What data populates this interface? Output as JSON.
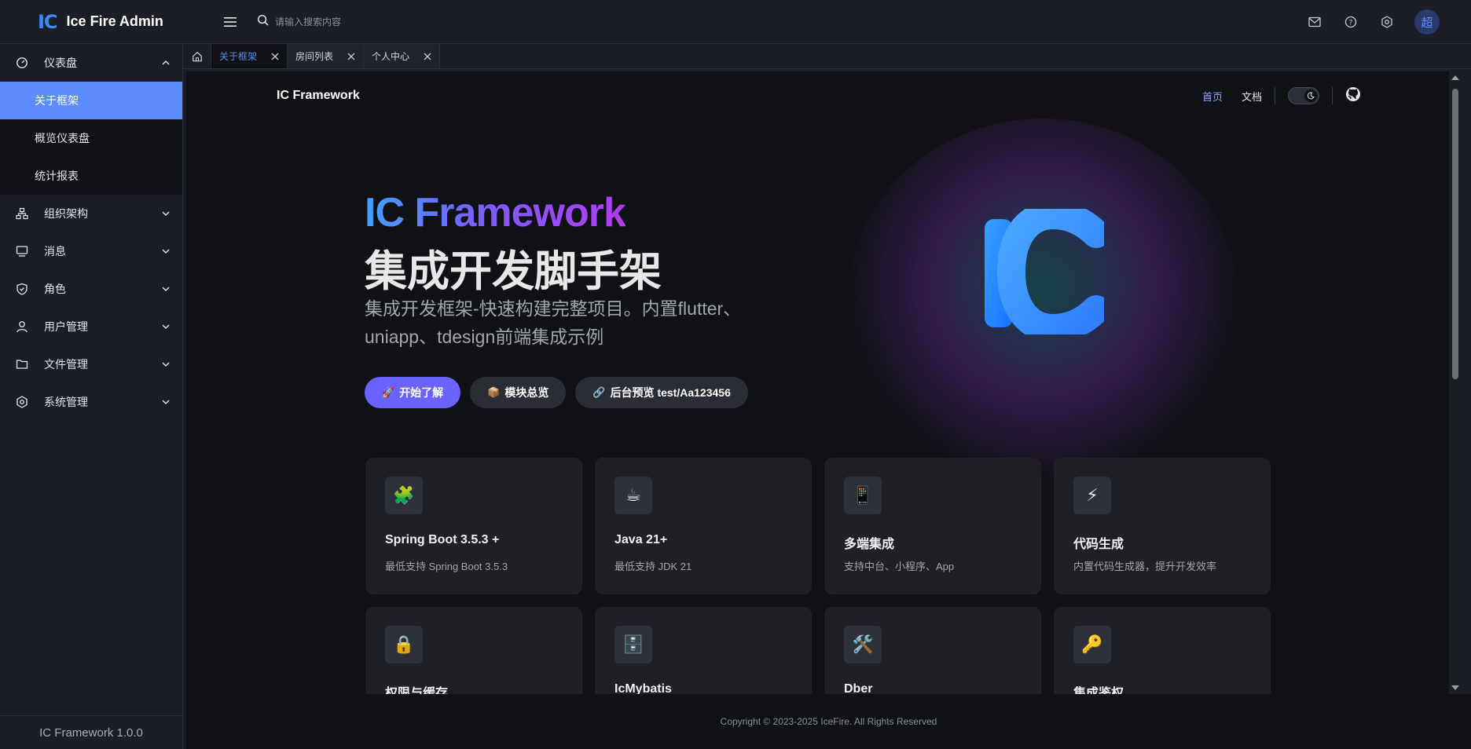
{
  "app": {
    "logo_mark": "IC",
    "title": "Ice Fire Admin",
    "avatar_text": "超"
  },
  "search": {
    "placeholder": "请输入搜索内容"
  },
  "sidebar": {
    "groups": [
      {
        "label": "仪表盘",
        "icon": "dashboard-icon",
        "expanded": true,
        "items": [
          {
            "label": "关于框架",
            "active": true
          },
          {
            "label": "概览仪表盘"
          },
          {
            "label": "统计报表"
          }
        ]
      },
      {
        "label": "组织架构",
        "icon": "org-chart-icon"
      },
      {
        "label": "消息",
        "icon": "message-icon"
      },
      {
        "label": "角色",
        "icon": "shield-icon"
      },
      {
        "label": "用户管理",
        "icon": "user-icon"
      },
      {
        "label": "文件管理",
        "icon": "folder-icon"
      },
      {
        "label": "系统管理",
        "icon": "gear-icon"
      }
    ],
    "footer": "IC Framework 1.0.0"
  },
  "tabs": [
    {
      "label": "关于框架",
      "active": true
    },
    {
      "label": "房间列表"
    },
    {
      "label": "个人中心"
    }
  ],
  "page": {
    "brand": "IC Framework",
    "nav": {
      "home": "首页",
      "docs": "文档"
    },
    "hero": {
      "title1": "IC Framework",
      "title2": "集成开发脚手架",
      "subtitle": "集成开发框架-快速构建完整项目。内置flutter、uniapp、tdesign前端集成示例"
    },
    "buttons": [
      {
        "emoji": "🚀",
        "label": "开始了解"
      },
      {
        "emoji": "📦",
        "label": "模块总览"
      },
      {
        "emoji": "🔗",
        "label": "后台预览 test/Aa123456"
      }
    ],
    "features": [
      {
        "emoji": "🧩",
        "title": "Spring Boot 3.5.3 +",
        "desc": "最低支持 Spring Boot 3.5.3"
      },
      {
        "emoji": "☕",
        "title": "Java 21+",
        "desc": "最低支持 JDK 21"
      },
      {
        "emoji": "📱",
        "title": "多端集成",
        "desc": "支持中台、小程序、App"
      },
      {
        "emoji": "⚡",
        "title": "代码生成",
        "desc": "内置代码生成器，提升开发效率"
      },
      {
        "emoji": "🔒",
        "title": "权限与缓存",
        "desc": ""
      },
      {
        "emoji": "🗄️",
        "title": "IcMybatis",
        "desc": ""
      },
      {
        "emoji": "🛠️",
        "title": "Dber",
        "desc": ""
      },
      {
        "emoji": "🔑",
        "title": "集成鉴权",
        "desc": ""
      }
    ],
    "copyright": "Copyright © 2023-2025 IceFire. All Rights Reserved"
  },
  "colors": {
    "accent": "#5b8dff",
    "primary_button": "#6b63ff",
    "logo_blue": "#3a8bff"
  }
}
